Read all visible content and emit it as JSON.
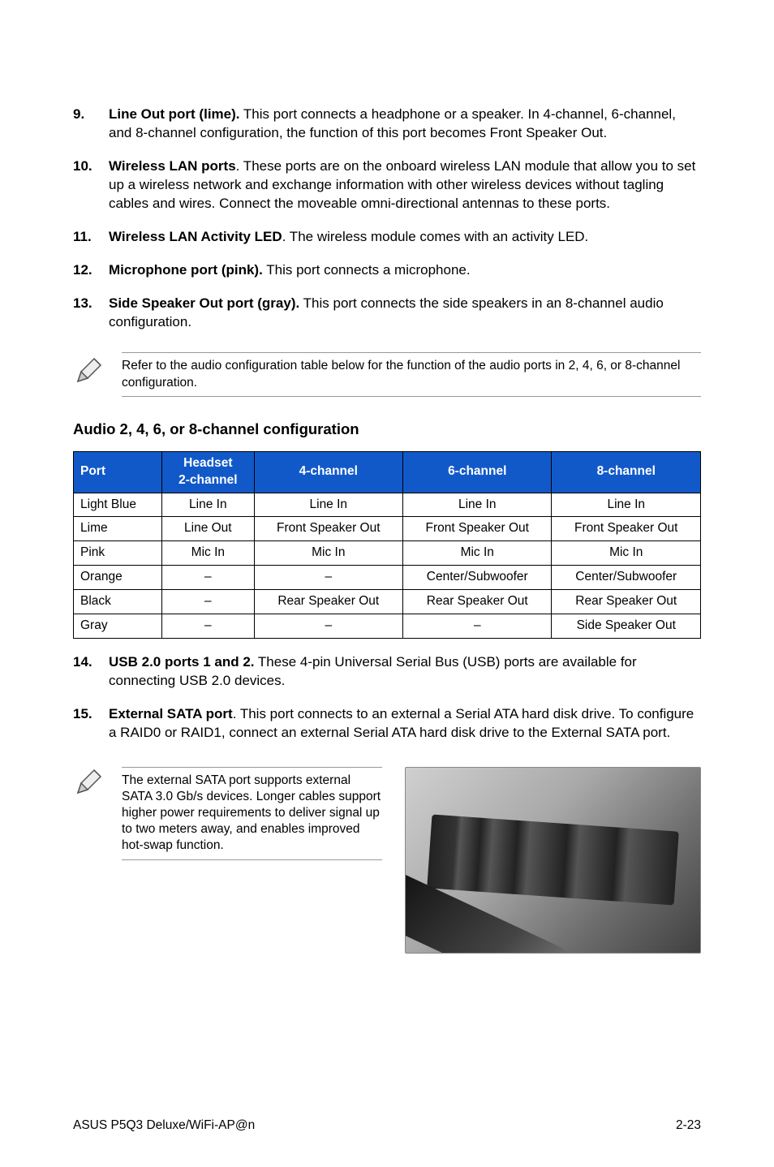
{
  "items": {
    "i9": {
      "num": "9.",
      "lead": "Line Out port (lime).",
      "rest": " This port connects a headphone or a speaker. In 4-channel, 6-channel, and 8-channel configuration, the function of this port becomes Front Speaker Out."
    },
    "i10": {
      "num": "10.",
      "lead": "Wireless LAN ports",
      "rest": ". These ports are on the onboard wireless LAN module that allow you to set up a wireless network and exchange information with other wireless devices without tagling cables and wires. Connect the moveable omni-directional antennas to these ports."
    },
    "i11": {
      "num": "11.",
      "lead": "Wireless LAN Activity LED",
      "rest": ". The wireless module comes with an activity LED."
    },
    "i12": {
      "num": "12.",
      "lead": "Microphone port (pink).",
      "rest": " This port connects a microphone."
    },
    "i13": {
      "num": "13.",
      "lead": "Side Speaker Out port (gray).",
      "rest": " This port connects the side speakers in an 8-channel audio configuration."
    },
    "i14": {
      "num": "14.",
      "lead": "USB 2.0 ports 1 and 2.",
      "rest": " These 4-pin Universal Serial Bus (USB) ports are available for connecting USB 2.0 devices."
    },
    "i15": {
      "num": "15.",
      "lead": "External SATA port",
      "rest": ". This port connects to an external a Serial ATA hard disk drive. To configure a RAID0 or RAID1, connect an external Serial ATA hard disk drive to the External SATA port."
    }
  },
  "note1": "Refer to the audio configuration table below for the function of the audio ports in 2, 4, 6, or 8-channel configuration.",
  "section_title": "Audio 2, 4, 6, or 8-channel configuration",
  "table": {
    "headers": {
      "port": "Port",
      "h2a": "Headset",
      "h2b": "2-channel",
      "h4": "4-channel",
      "h6": "6-channel",
      "h8": "8-channel"
    },
    "rows": [
      {
        "port": "Light Blue",
        "c2": "Line In",
        "c4": "Line In",
        "c6": "Line In",
        "c8": "Line In"
      },
      {
        "port": "Lime",
        "c2": "Line Out",
        "c4": "Front Speaker Out",
        "c6": "Front Speaker Out",
        "c8": "Front Speaker Out"
      },
      {
        "port": "Pink",
        "c2": "Mic In",
        "c4": "Mic In",
        "c6": "Mic In",
        "c8": "Mic In"
      },
      {
        "port": "Orange",
        "c2": "–",
        "c4": "–",
        "c6": "Center/Subwoofer",
        "c8": "Center/Subwoofer"
      },
      {
        "port": "Black",
        "c2": "–",
        "c4": "Rear Speaker Out",
        "c6": "Rear Speaker Out",
        "c8": "Rear Speaker Out"
      },
      {
        "port": "Gray",
        "c2": "–",
        "c4": "–",
        "c6": "–",
        "c8": "Side Speaker Out"
      }
    ]
  },
  "note2": "The external SATA port supports external SATA 3.0 Gb/s devices. Longer cables support higher power requirements to deliver signal up to two meters away, and enables improved hot-swap function.",
  "footer": {
    "left": "ASUS P5Q3 Deluxe/WiFi-AP@n",
    "right": "2-23"
  }
}
